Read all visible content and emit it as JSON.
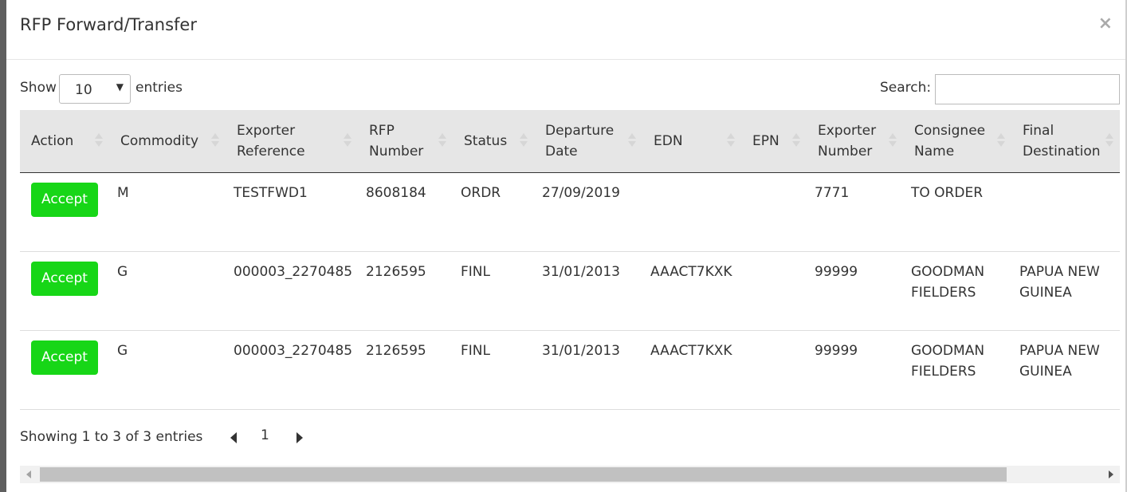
{
  "modal": {
    "title": "RFP Forward/Transfer",
    "close_icon": "×"
  },
  "length": {
    "show_label": "Show",
    "selected": "10",
    "entries_label": "entries"
  },
  "search": {
    "label": "Search:",
    "value": ""
  },
  "table": {
    "columns": [
      "Action",
      "Commodity",
      "Exporter Reference",
      "RFP Number",
      "Status",
      "Departure Date",
      "EDN",
      "EPN",
      "Exporter Number",
      "Consignee Name",
      "Final Destination"
    ],
    "rows": [
      {
        "action": "Accept",
        "commodity": "M",
        "exporter_reference": "TESTFWD1",
        "rfp_number": "8608184",
        "status": "ORDR",
        "departure_date": "27/09/2019",
        "edn": "",
        "epn": "",
        "exporter_number": "7771",
        "consignee_name": "TO ORDER",
        "final_destination": ""
      },
      {
        "action": "Accept",
        "commodity": "G",
        "exporter_reference": "000003_2270485",
        "rfp_number": "2126595",
        "status": "FINL",
        "departure_date": "31/01/2013",
        "edn": "AAACT7KXK",
        "epn": "",
        "exporter_number": "99999",
        "consignee_name": "GOODMAN FIELDERS",
        "final_destination": "PAPUA NEW GUINEA"
      },
      {
        "action": "Accept",
        "commodity": "G",
        "exporter_reference": "000003_2270485",
        "rfp_number": "2126595",
        "status": "FINL",
        "departure_date": "31/01/2013",
        "edn": "AAACT7KXK",
        "epn": "",
        "exporter_number": "99999",
        "consignee_name": "GOODMAN FIELDERS",
        "final_destination": "PAPUA NEW GUINEA"
      }
    ]
  },
  "footer": {
    "info": "Showing 1 to 3 of 3 entries",
    "current_page": "1"
  },
  "colors": {
    "accept_button": "#17d617",
    "header_bg": "#e6e6e6"
  }
}
